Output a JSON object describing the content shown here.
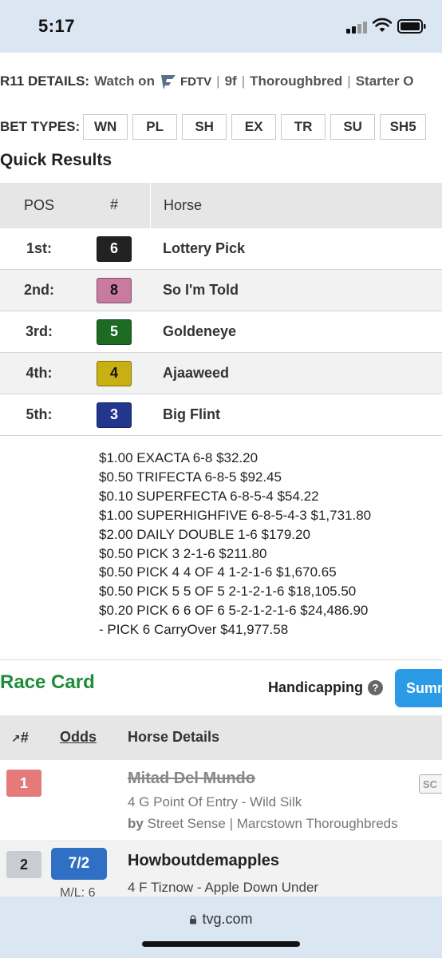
{
  "status_bar": {
    "time": "5:17"
  },
  "race_details": {
    "label": "R11 DETAILS:",
    "watch": "Watch on",
    "network": "FDTV",
    "distance": "9f",
    "breed": "Thoroughbred",
    "starter": "Starter O"
  },
  "bet_types": {
    "label": "BET TYPES:",
    "buttons": [
      "WN",
      "PL",
      "SH",
      "EX",
      "TR",
      "SU",
      "SH5"
    ]
  },
  "quick_results": {
    "title": "Quick Results",
    "columns": {
      "pos": "POS",
      "num": "#",
      "horse": "Horse"
    },
    "rows": [
      {
        "pos": "1st:",
        "num": "6",
        "horse": "Lottery Pick",
        "color": "#222222",
        "text_color": "#ffffff"
      },
      {
        "pos": "2nd:",
        "num": "8",
        "horse": "So I'm Told",
        "color": "#c97aa0",
        "text_color": "#111111"
      },
      {
        "pos": "3rd:",
        "num": "5",
        "horse": "Goldeneye",
        "color": "#1d6b23",
        "text_color": "#ffffff"
      },
      {
        "pos": "4th:",
        "num": "4",
        "horse": "Ajaaweed",
        "color": "#c9b012",
        "text_color": "#111111"
      },
      {
        "pos": "5th:",
        "num": "3",
        "horse": "Big Flint",
        "color": "#23368e",
        "text_color": "#ffffff"
      }
    ],
    "payouts": [
      "$1.00 EXACTA 6-8 $32.20",
      "$0.50 TRIFECTA 6-8-5 $92.45",
      "$0.10 SUPERFECTA 6-8-5-4 $54.22",
      "$1.00 SUPERHIGHFIVE 6-8-5-4-3 $1,731.80",
      "$2.00 DAILY DOUBLE 1-6 $179.20",
      "$0.50 PICK 3 2-1-6 $211.80",
      "$0.50 PICK 4 4 OF 4 1-2-1-6 $1,670.65",
      "$0.50 PICK 5 5 OF 5 2-1-2-1-6 $18,105.50",
      "$0.20 PICK 6 6 OF 6 5-2-1-2-1-6 $24,486.90",
      "- PICK 6 CarryOver $41,977.58"
    ]
  },
  "race_card": {
    "title": "Race Card",
    "handicapping": "Handicapping",
    "help": "?",
    "summary_button": "Summ",
    "columns": {
      "sort": "#",
      "odds": "Odds",
      "details": "Horse Details"
    },
    "entries": [
      {
        "num": "1",
        "name": "Mitad Del Mundo",
        "sub": "4 G Point Of Entry - Wild Silk",
        "by_label": "by",
        "by": "Street Sense | Marcstown Thoroughbreds",
        "badge": "SC",
        "color": "#e57a7a",
        "text_color": "#ffffff"
      },
      {
        "num": "2",
        "odds": "7/2",
        "ml": "M/L: 6",
        "name": "Howboutdemapples",
        "sub": "4 F Tiznow - Apple Down Under",
        "color": "#c9cdd3",
        "text_color": "#222222"
      }
    ]
  },
  "browser": {
    "url": "tvg.com"
  },
  "colors": {
    "accent_green": "#1e8c3a",
    "accent_blue": "#2c9be6",
    "odds_blue": "#2f6fc4"
  }
}
